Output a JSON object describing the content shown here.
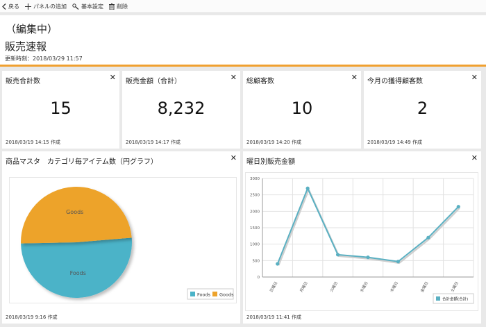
{
  "toolbar": {
    "back_label": "戻る",
    "add_panel_label": "パネルの追加",
    "settings_label": "基本設定",
    "delete_label": "削除"
  },
  "header": {
    "mode_label": "（編集中）",
    "title": "販売速報",
    "updated": "更新時刻：2018/03/29 11:57"
  },
  "kpis": [
    {
      "title": "販売合計数",
      "value": "15",
      "footer": "2018/03/19 14:15 作成"
    },
    {
      "title": "販売金額（合計）",
      "value": "8,232",
      "footer": "2018/03/19 14:17 作成"
    },
    {
      "title": "総顧客数",
      "value": "10",
      "footer": "2018/03/19 14:20 作成"
    },
    {
      "title": "今月の獲得顧客数",
      "value": "2",
      "footer": "2018/03/19 14:49 作成"
    }
  ],
  "pie_panel": {
    "title": "商品マスタ　カテゴリ毎アイテム数（円グラフ）",
    "footer": "2018/03/19 9:16 作成"
  },
  "line_panel": {
    "title": "曜日別販売金額",
    "footer": "2018/03/19 11:41 作成"
  },
  "close_glyph": "✕",
  "colors": {
    "accent": "#f0a030",
    "goods": "#eda32b",
    "foods": "#4bb3c8",
    "line": "#5ab0c2"
  },
  "chart_data": [
    {
      "type": "pie",
      "categories": [
        "Foods",
        "Goods"
      ],
      "values": [
        51,
        49
      ],
      "legend": [
        "Foods",
        "Goods"
      ],
      "legend_position": "bottom-right"
    },
    {
      "type": "line",
      "categories": [
        "日曜日",
        "月曜日",
        "火曜日",
        "水曜日",
        "木曜日",
        "金曜日",
        "土曜日"
      ],
      "series": [
        {
          "name": "合計金額(合計)",
          "values": [
            400,
            2700,
            680,
            600,
            470,
            1200,
            2140
          ]
        }
      ],
      "yticks": [
        "0",
        "500",
        "1000",
        "1500",
        "2000",
        "2500",
        "3000"
      ],
      "ylim": [
        0,
        3000
      ],
      "grid": true,
      "legend_position": "bottom-right"
    }
  ]
}
